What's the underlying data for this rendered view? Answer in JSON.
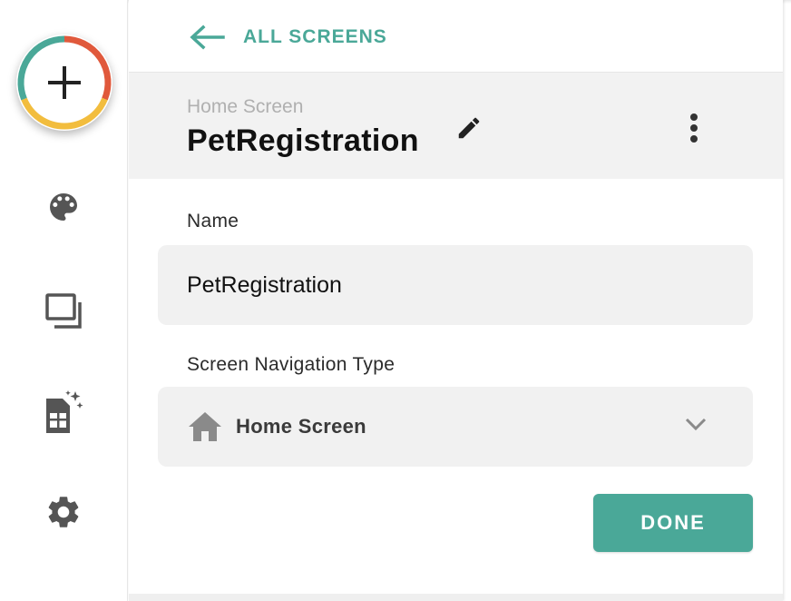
{
  "back_link": {
    "label": "ALL SCREENS"
  },
  "header": {
    "subtitle": "Home Screen",
    "title": "PetRegistration"
  },
  "name_field": {
    "label": "Name",
    "value": "PetRegistration"
  },
  "nav_type_field": {
    "label": "Screen Navigation Type",
    "value": "Home Screen"
  },
  "done_button": {
    "label": "DONE"
  },
  "colors": {
    "accent": "#4aa898",
    "ring_red": "#e0593c",
    "ring_yellow": "#f2bd3e",
    "ring_teal": "#4aa898"
  },
  "sidebar_icons": [
    "add-icon",
    "palette-icon",
    "screens-icon",
    "data-sheet-icon",
    "gear-icon"
  ]
}
